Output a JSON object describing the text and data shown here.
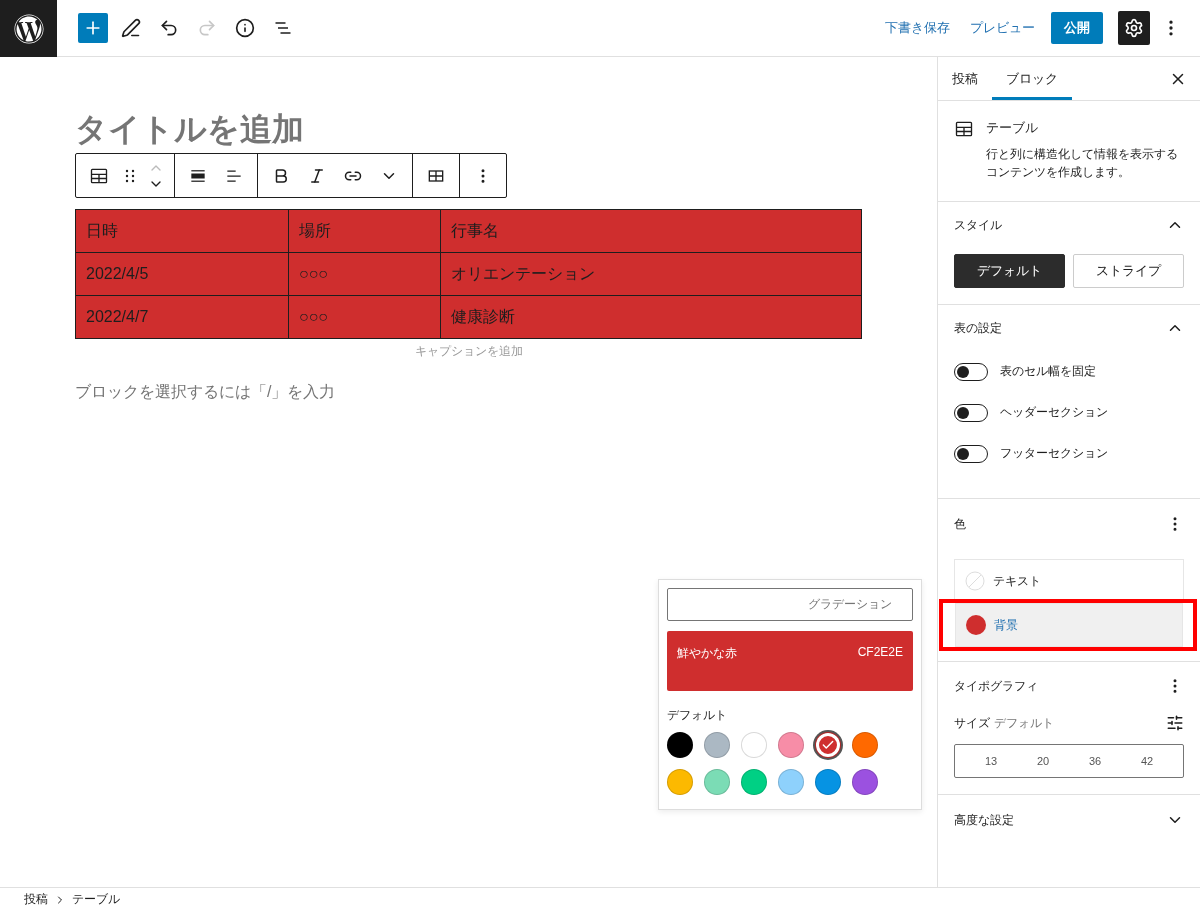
{
  "topbar": {
    "redo_disabled": true,
    "links": [
      "下書き保存",
      "プレビュー"
    ],
    "publish": "公開",
    "settings_active": true
  },
  "editor": {
    "title_placeholder": "タイトルを追加",
    "table": {
      "color": "#cf2e2e",
      "rows": [
        [
          "日時",
          "場所",
          "行事名"
        ],
        [
          "2022/4/5",
          "○○○",
          "オリエンテーション"
        ],
        [
          "2022/4/7",
          "○○○",
          "健康診断"
        ]
      ]
    },
    "caption_placeholder": "キャプションを追加",
    "block_placeholder": "ブロックを選択するには「/」を入力"
  },
  "color_popover": {
    "tab": "グラデーション",
    "current": {
      "name": "鮮やかな赤",
      "hex": "CF2E2E",
      "color": "#cf2e2e"
    },
    "palette_label": "デフォルト",
    "swatches": [
      {
        "color": "#000000",
        "selected": false
      },
      {
        "color": "#abb8c3",
        "selected": false
      },
      {
        "color": "#ffffff",
        "selected": false
      },
      {
        "color": "#f78da7",
        "selected": false
      },
      {
        "color": "#cf2e2e",
        "selected": true
      },
      {
        "color": "#ff6900",
        "selected": false
      },
      {
        "color": "#fcb900",
        "selected": false
      },
      {
        "color": "#7bdcb5",
        "selected": false
      },
      {
        "color": "#00d084",
        "selected": false
      },
      {
        "color": "#8ed1fc",
        "selected": false
      },
      {
        "color": "#0693e3",
        "selected": false
      },
      {
        "color": "#9b51e0",
        "selected": false
      }
    ]
  },
  "sidebar": {
    "tabs": [
      {
        "label": "投稿",
        "selected": false
      },
      {
        "label": "ブロック",
        "selected": true
      }
    ],
    "block": {
      "name": "テーブル",
      "description": "行と列に構造化して情報を表示するコンテンツを作成します。"
    },
    "style": {
      "title": "スタイル",
      "expanded": true,
      "options": [
        {
          "label": "デフォルト",
          "selected": true
        },
        {
          "label": "ストライプ",
          "selected": false
        }
      ]
    },
    "table_settings": {
      "title": "表の設定",
      "expanded": true,
      "toggles": [
        {
          "label": "表のセル幅を固定",
          "on": false
        },
        {
          "label": "ヘッダーセクション",
          "on": false
        },
        {
          "label": "フッターセクション",
          "on": false
        }
      ]
    },
    "color": {
      "title": "色",
      "items": [
        {
          "label": "テキスト",
          "kind": "empty",
          "selected": false,
          "highlighted": false
        },
        {
          "label": "背景",
          "kind": "swatch",
          "color": "#cf2e2e",
          "selected": true,
          "highlighted": true
        }
      ]
    },
    "typography": {
      "title": "タイポグラフィ",
      "size_label": "サイズ",
      "size_value": "デフォルト",
      "sizes": [
        "13",
        "20",
        "36",
        "42"
      ]
    },
    "advanced": {
      "title": "高度な設定",
      "expanded": false
    }
  },
  "breadcrumb": [
    "投稿",
    "テーブル"
  ]
}
